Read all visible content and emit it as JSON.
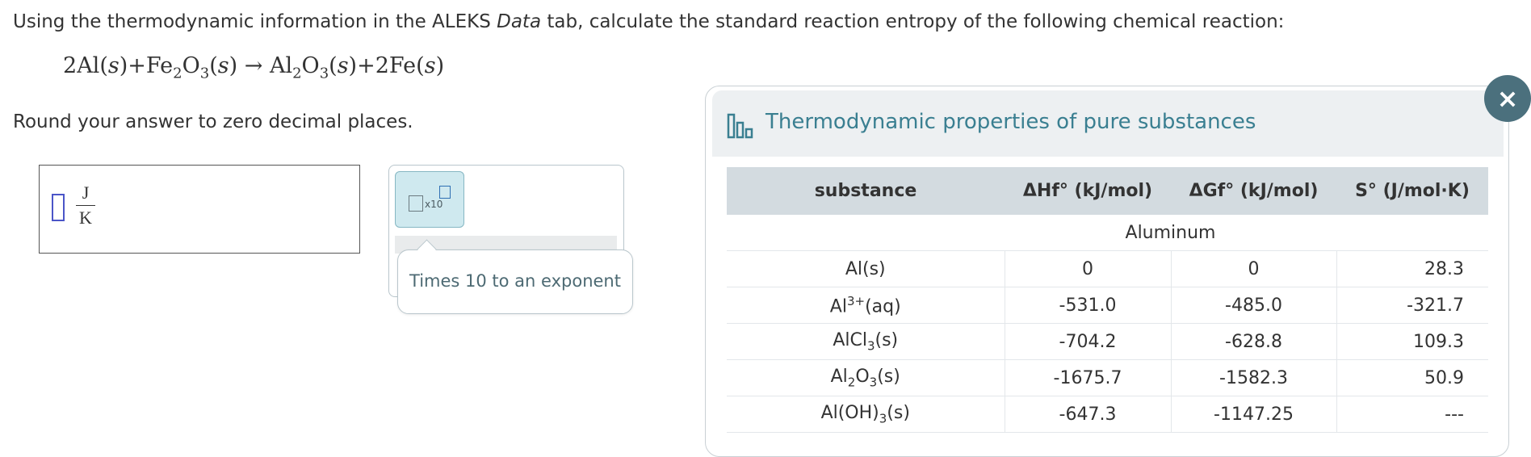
{
  "question": {
    "prompt_before": "Using the thermodynamic information in the ALEKS ",
    "prompt_italic": "Data",
    "prompt_after": " tab, calculate the standard reaction entropy of the following chemical reaction:",
    "round_instruction": "Round your answer to zero decimal places."
  },
  "equation": {
    "coef1": "2",
    "al": "Al",
    "state": "s",
    "plus": "+",
    "fe": "Fe",
    "o": "O",
    "sub2": "2",
    "sub3": "3",
    "arrow": "→",
    "coef2": "2"
  },
  "answer": {
    "value": "",
    "unit_numerator": "J",
    "unit_denominator": "K"
  },
  "toolbar": {
    "x10_label": "x10",
    "tooltip": "Times 10 to an exponent"
  },
  "data_tab": {
    "title": "Thermodynamic properties of pure substances",
    "close_label": "×",
    "columns": [
      "substance",
      "ΔHf° (kJ/mol)",
      "ΔGf° (kJ/mol)",
      "S° (J/mol·K)"
    ],
    "group": "Aluminum",
    "rows": [
      {
        "name": "Al(s)",
        "dH": "0",
        "dG": "0",
        "S": "28.3"
      },
      {
        "name": "Al3+(aq)",
        "dH": "-531.0",
        "dG": "-485.0",
        "S": "-321.7"
      },
      {
        "name": "AlCl3(s)",
        "dH": "-704.2",
        "dG": "-628.8",
        "S": "109.3"
      },
      {
        "name": "Al2O3(s)",
        "dH": "-1675.7",
        "dG": "-1582.3",
        "S": "50.9"
      },
      {
        "name": "Al(OH)3(s)",
        "dH": "-647.3",
        "dG": "-1147.25",
        "S": "---"
      }
    ]
  },
  "colors": {
    "accent": "#3a7f91",
    "close_bg": "#4b707d",
    "input_border": "#4b55c8",
    "header_bg": "#d3dbe0"
  }
}
